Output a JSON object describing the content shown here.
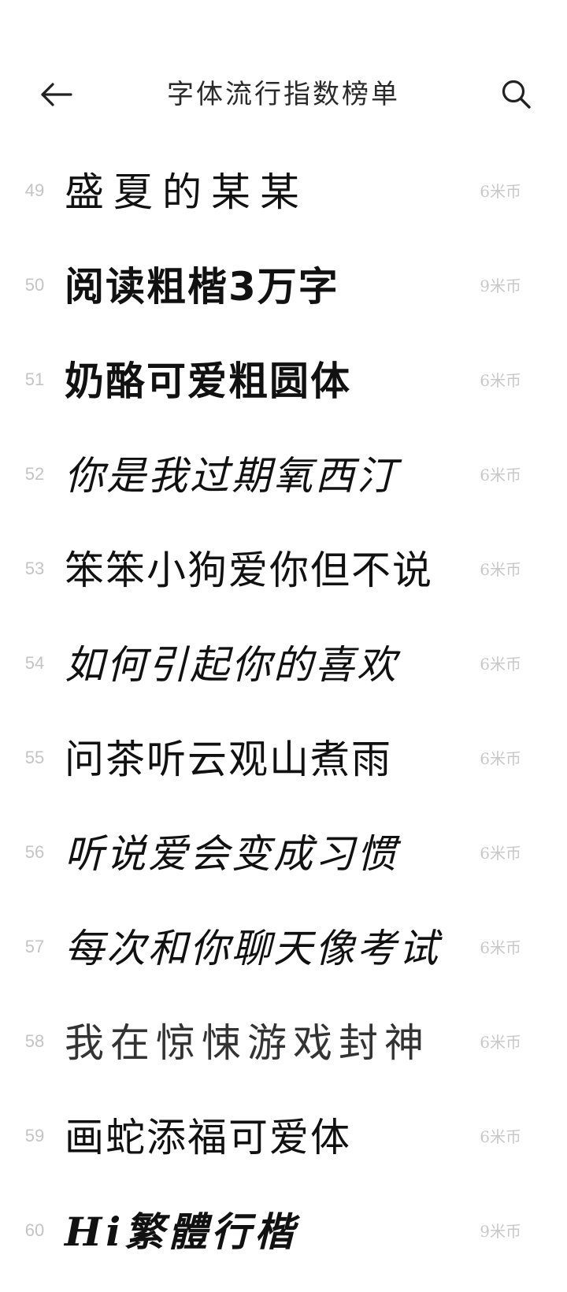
{
  "header": {
    "back_icon": "back-arrow-icon",
    "title": "字体流行指数榜单",
    "search_icon": "search-icon"
  },
  "fonts": [
    {
      "rank": "49",
      "name": "盛夏的某某",
      "price": "6米币",
      "style": "s-hand"
    },
    {
      "rank": "50",
      "name": "阅读粗楷3万字",
      "price": "9米币",
      "style": "s-heavy"
    },
    {
      "rank": "51",
      "name": "奶酪可爱粗圆体",
      "price": "6米币",
      "style": "s-heavy"
    },
    {
      "rank": "52",
      "name": "你是我过期氧西汀",
      "price": "6米币",
      "style": "s-script"
    },
    {
      "rank": "53",
      "name": "笨笨小狗爱你但不说",
      "price": "6米币",
      "style": "s-round"
    },
    {
      "rank": "54",
      "name": "如何引起你的喜欢",
      "price": "6米币",
      "style": "s-script"
    },
    {
      "rank": "55",
      "name": "问茶听云观山煮雨",
      "price": "6米币",
      "style": "s-round"
    },
    {
      "rank": "56",
      "name": "听说爱会变成习惯",
      "price": "6米币",
      "style": "s-script"
    },
    {
      "rank": "57",
      "name": "每次和你聊天像考试",
      "price": "6米币",
      "style": "s-script"
    },
    {
      "rank": "58",
      "name": "我在惊悚游戏封神",
      "price": "6米币",
      "style": "s-light"
    },
    {
      "rank": "59",
      "name": "画蛇添福可爱体",
      "price": "6米币",
      "style": "s-round"
    },
    {
      "rank": "60",
      "name": "Hi繁體行楷",
      "price": "9米币",
      "style": "s-trad"
    }
  ]
}
